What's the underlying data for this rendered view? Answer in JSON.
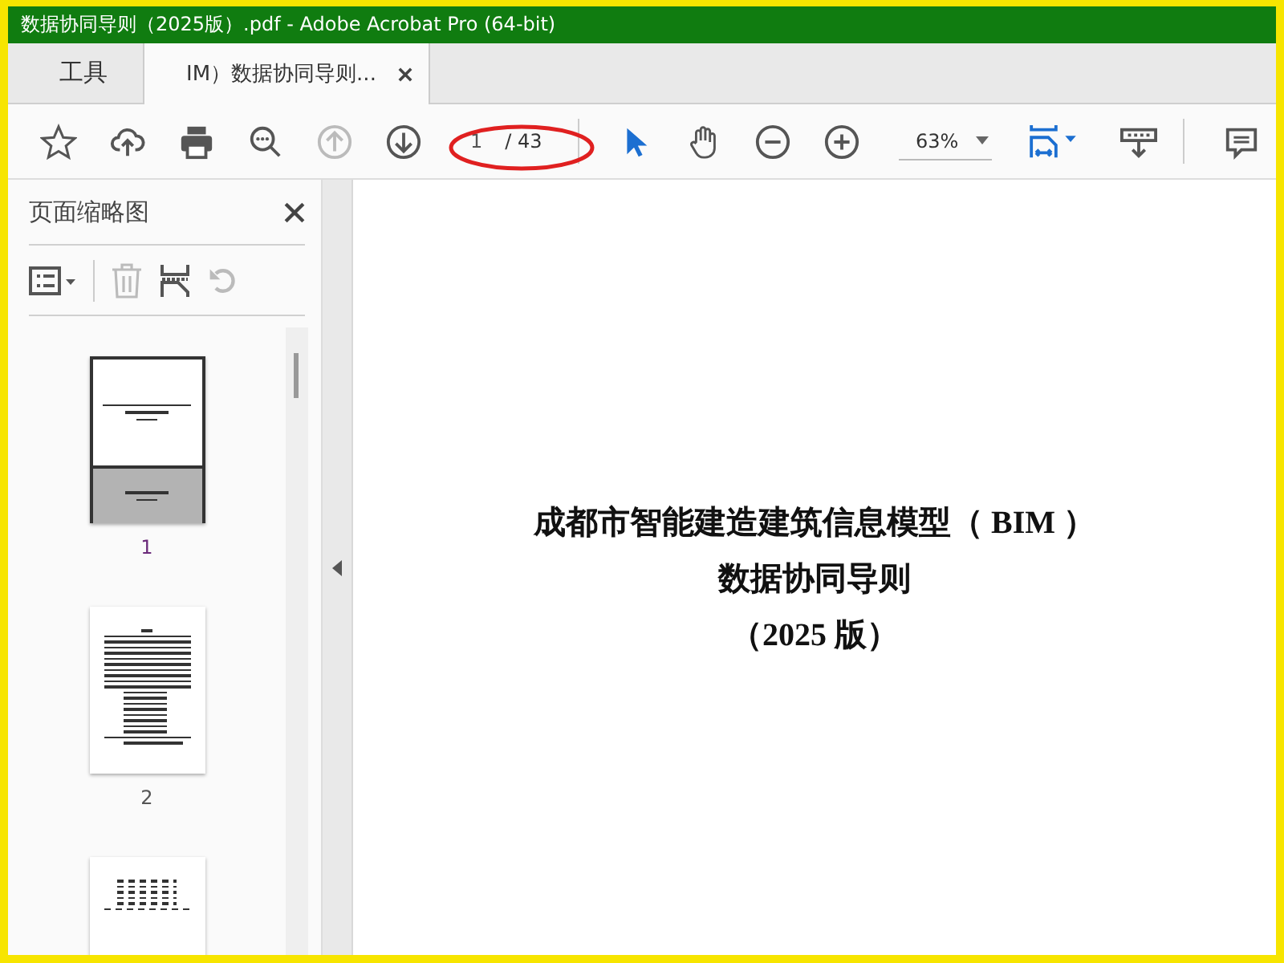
{
  "window": {
    "title": "数据协同导则（2025版）.pdf - Adobe Acrobat Pro (64-bit)"
  },
  "tabs": [
    {
      "label": "工具",
      "selected": false,
      "closable": false
    },
    {
      "label": "IM）数据协同导则...",
      "selected": true,
      "closable": true
    }
  ],
  "toolbar": {
    "tools": [
      {
        "kind": "star",
        "disabled": false
      },
      {
        "kind": "upload",
        "disabled": false
      },
      {
        "kind": "print",
        "disabled": false
      },
      {
        "kind": "find",
        "disabled": false
      },
      {
        "kind": "prev",
        "disabled": true
      },
      {
        "kind": "next",
        "disabled": false
      }
    ],
    "page_number": "1",
    "page_total": "/ 43",
    "tools2": [
      {
        "kind": "pointer",
        "selected": true
      },
      {
        "kind": "hand",
        "selected": false
      },
      {
        "kind": "zoomout",
        "selected": false
      },
      {
        "kind": "zoomin",
        "selected": false
      }
    ],
    "zoom": "63%"
  },
  "sidebar": {
    "title": "页面缩略图",
    "tools": [
      {
        "kind": "trash",
        "disabled": true
      },
      {
        "kind": "insert",
        "disabled": false
      },
      {
        "kind": "rotate",
        "disabled": true
      }
    ],
    "thumbnails": [
      {
        "kind": "cover",
        "label": "1",
        "selected": true
      },
      {
        "kind": "text",
        "label": "2",
        "selected": false
      },
      {
        "kind": "table",
        "selected": false
      }
    ]
  },
  "document": {
    "title_lines": [
      "成都市智能建造建筑信息模型（ BIM ）",
      "数据协同导则",
      "（2025 版）"
    ]
  }
}
